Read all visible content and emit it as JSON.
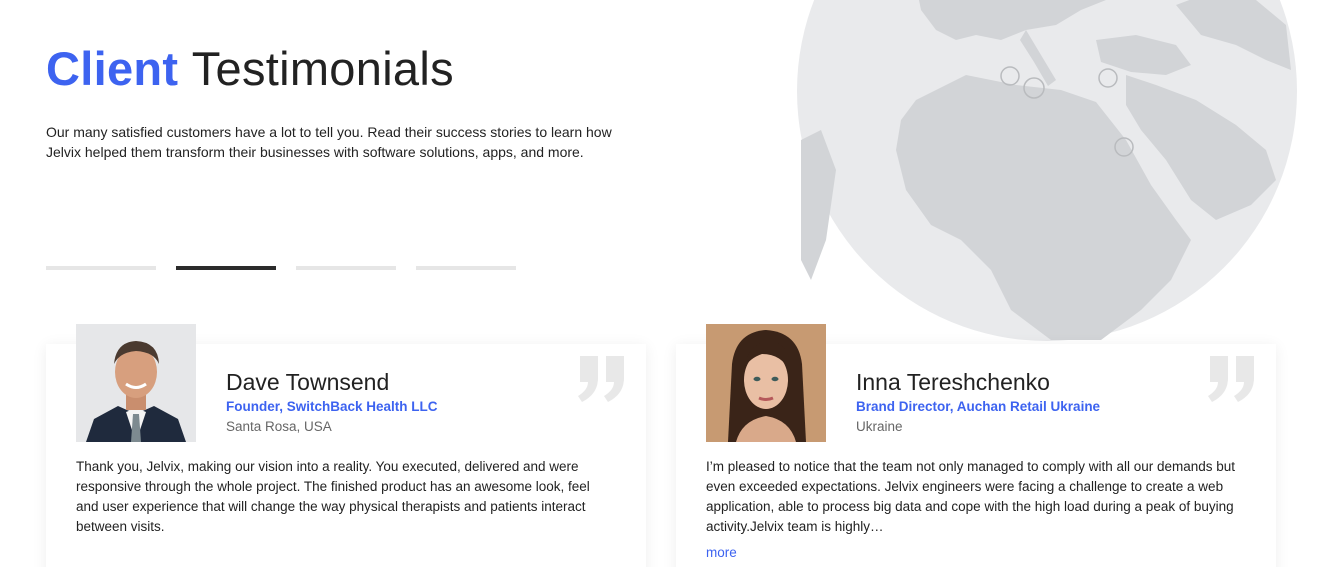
{
  "colors": {
    "accent": "#3d63f0",
    "globe": "#d2d4d7",
    "text": "#222222"
  },
  "header": {
    "title_highlight": "Client",
    "title_rest": "Testimonials",
    "intro": "Our many satisfied customers have a lot to tell you. Read their success stories to learn how Jelvix helped them transform their businesses with software solutions, apps, and more."
  },
  "pager": {
    "count": 4,
    "active_index": 1
  },
  "testimonials": [
    {
      "name": "Dave Townsend",
      "role": "Founder, SwitchBack Health LLC",
      "location": "Santa Rosa, USA",
      "text": "Thank you, Jelvix, making our vision into a reality. You executed, delivered and were responsive through the whole project. The finished product has an awesome look, feel and user experience that will change the way physical therapists and patients interact between visits.",
      "icon": "quote-icon"
    },
    {
      "name": "Inna Tereshchenko",
      "role": "Brand Director, Auchan Retail Ukraine",
      "location": "Ukraine",
      "text": "I’m pleased to notice that the team not only managed to comply with all our demands but even exceeded expectations. Jelvix engineers were facing a challenge to create a web application, able to process big data and cope with the high load during a peak of buying activity.Jelvix team is highly…",
      "more_label": "more",
      "icon": "quote-icon"
    }
  ]
}
